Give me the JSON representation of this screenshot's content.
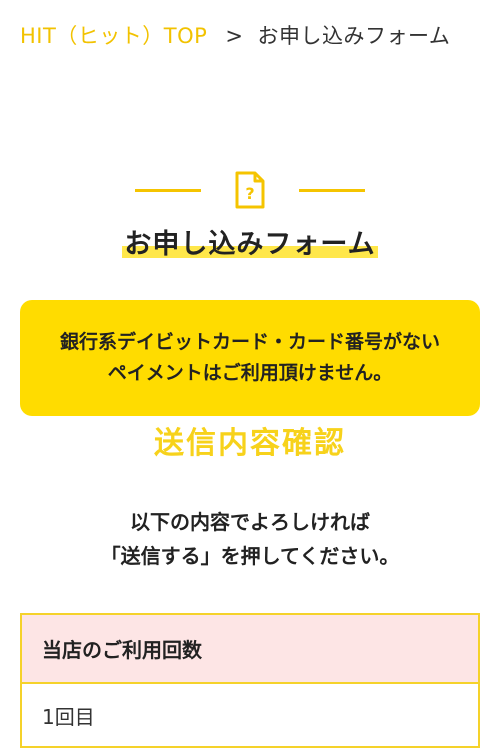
{
  "breadcrumb": {
    "home": "HIT（ヒット）TOP",
    "separator": ">",
    "current": "お申し込みフォーム"
  },
  "heading": {
    "icon": "document-question-icon",
    "title": "お申し込みフォーム"
  },
  "notice": {
    "line1": "銀行系デイビットカード・カード番号がない",
    "line2": "ペイメントはご利用頂けません。"
  },
  "section_title": "送信内容確認",
  "instruction": {
    "line1": "以下の内容でよろしければ",
    "line2": "「送信する」を押してください。"
  },
  "table": {
    "rows": [
      {
        "label": "当店のご利用回数",
        "value": "1回目"
      }
    ]
  },
  "colors": {
    "accent_yellow": "#ffdc00",
    "link_yellow": "#f2c200",
    "header_pink": "#fde5e5"
  }
}
